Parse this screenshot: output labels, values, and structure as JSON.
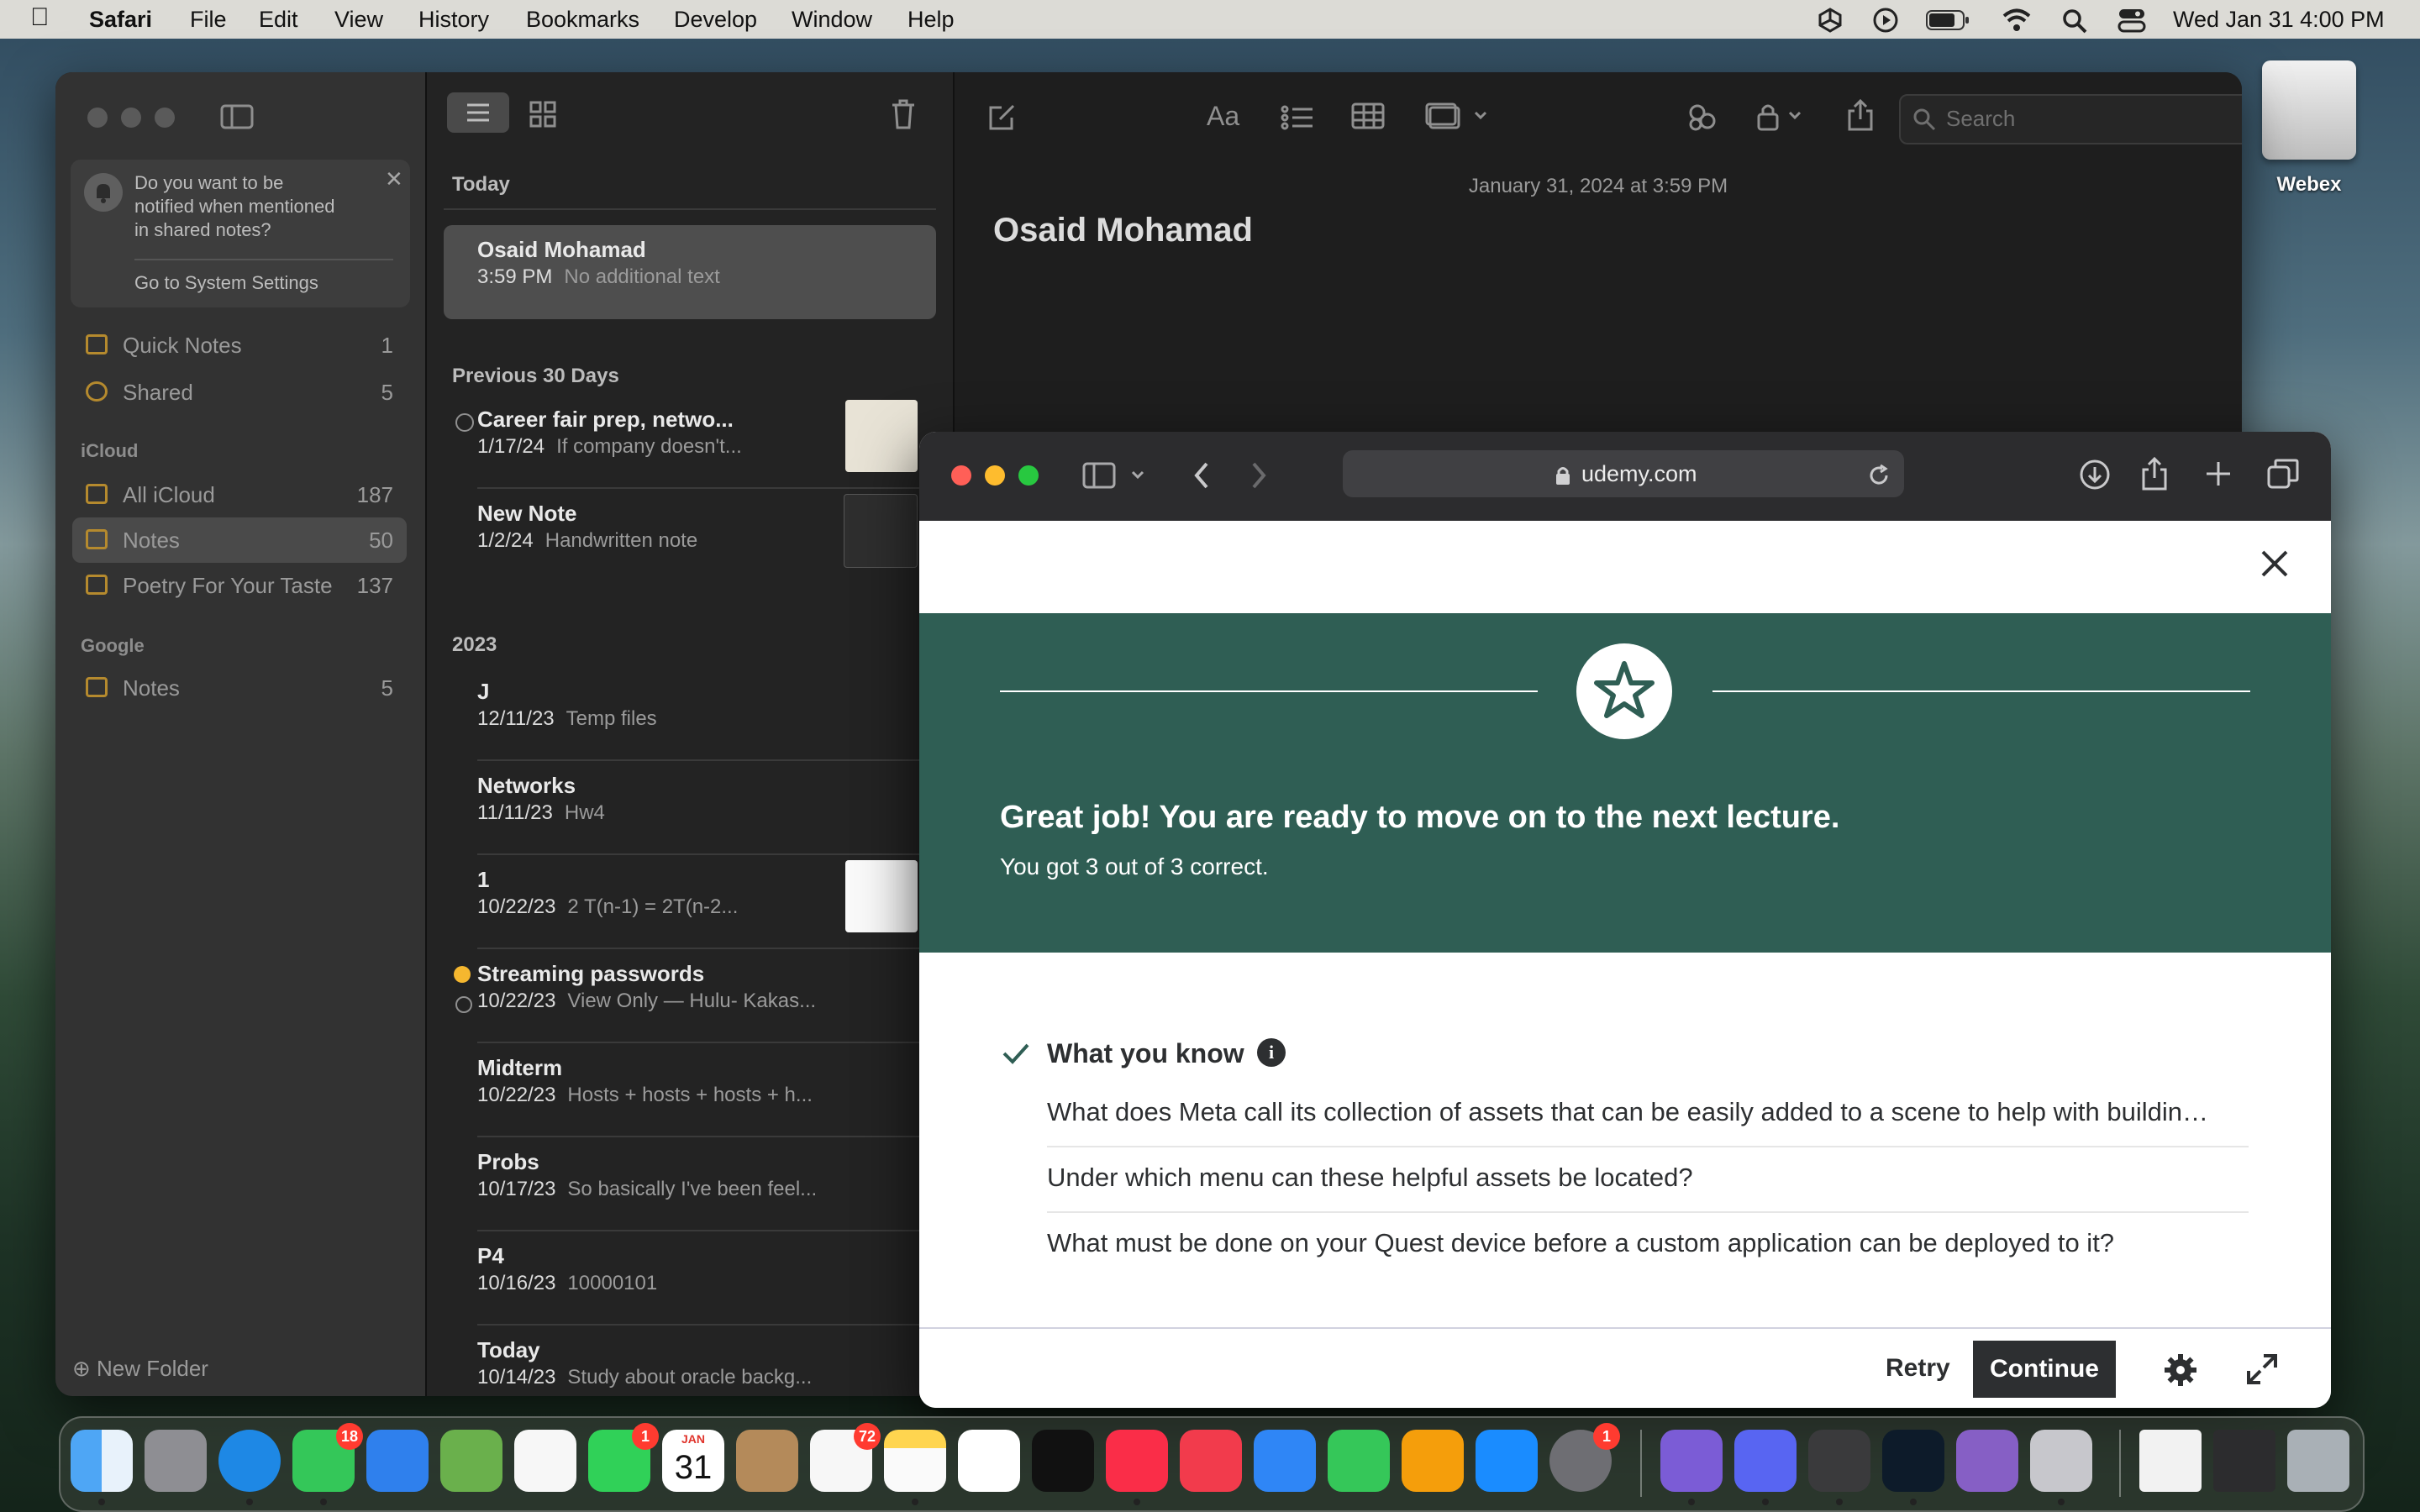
{
  "menubar": {
    "app": "Safari",
    "items": [
      "File",
      "Edit",
      "View",
      "History",
      "Bookmarks",
      "Develop",
      "Window",
      "Help"
    ],
    "clock": "Wed Jan 31  4:00 PM"
  },
  "desktop": {
    "disk_label": "Webex"
  },
  "notes": {
    "notify": {
      "text_lines": [
        "Do you want to be",
        "notified when mentioned",
        "in shared notes?"
      ],
      "link": "Go to System Settings"
    },
    "quick_notes": {
      "label": "Quick Notes",
      "count": "1"
    },
    "shared": {
      "label": "Shared",
      "count": "5"
    },
    "icloud_header": "iCloud",
    "icloud_folders": [
      {
        "label": "All iCloud",
        "count": "187"
      },
      {
        "label": "Notes",
        "count": "50"
      },
      {
        "label": "Poetry For Your Taste",
        "count": "137"
      }
    ],
    "google_header": "Google",
    "google_folders": [
      {
        "label": "Notes",
        "count": "5"
      }
    ],
    "new_folder": "New Folder",
    "sections": {
      "today": "Today",
      "prev30": "Previous 30 Days",
      "y2023": "2023"
    },
    "selected_note": {
      "title": "Osaid Mohamad",
      "time": "3:59 PM",
      "preview": "No additional text"
    },
    "prev30_notes": [
      {
        "title": "Career fair prep, netwo...",
        "date": "1/17/24",
        "preview": "If company doesn't..."
      },
      {
        "title": "New Note",
        "date": "1/2/24",
        "preview": "Handwritten note"
      }
    ],
    "notes_2023": [
      {
        "title": "J",
        "date": "12/11/23",
        "preview": "Temp files"
      },
      {
        "title": "Networks",
        "date": "11/11/23",
        "preview": "Hw4"
      },
      {
        "title": "1",
        "date": "10/22/23",
        "preview": "2 T(n-1) = 2T(n-2..."
      },
      {
        "title": "Streaming passwords",
        "date": "10/22/23",
        "preview": "View Only — Hulu- Kakas..."
      },
      {
        "title": "Midterm",
        "date": "10/22/23",
        "preview": "Hosts + hosts + hosts + h..."
      },
      {
        "title": "Probs",
        "date": "10/17/23",
        "preview": "So basically I've been feel..."
      },
      {
        "title": "P4",
        "date": "10/16/23",
        "preview": "10000101"
      },
      {
        "title": "Today",
        "date": "10/14/23",
        "preview": "Study about oracle backg..."
      }
    ],
    "editor": {
      "timestamp": "January 31, 2024 at 3:59 PM",
      "title": "Osaid Mohamad"
    },
    "search_placeholder": "Search"
  },
  "safari": {
    "url": "udemy.com",
    "result_title": "Great job! You are ready to move on to the next lecture.",
    "result_sub": "You got 3 out of 3 correct.",
    "section_title": "What you know",
    "questions": [
      "What does Meta call its collection of assets that can be easily added to a scene to help with buildin…",
      "Under which menu can these helpful assets be located?",
      "What must be done on your Quest device before a custom application can be deployed to it?"
    ],
    "retry": "Retry",
    "continue": "Continue",
    "colors": {
      "banner": "#2f5e54",
      "continue_bg": "#2d2f31"
    }
  },
  "dock": {
    "badges": {
      "messages": "18",
      "facetime": "1",
      "reminders": "72",
      "settings": "1"
    },
    "calendar": {
      "month": "JAN",
      "day": "31"
    }
  }
}
